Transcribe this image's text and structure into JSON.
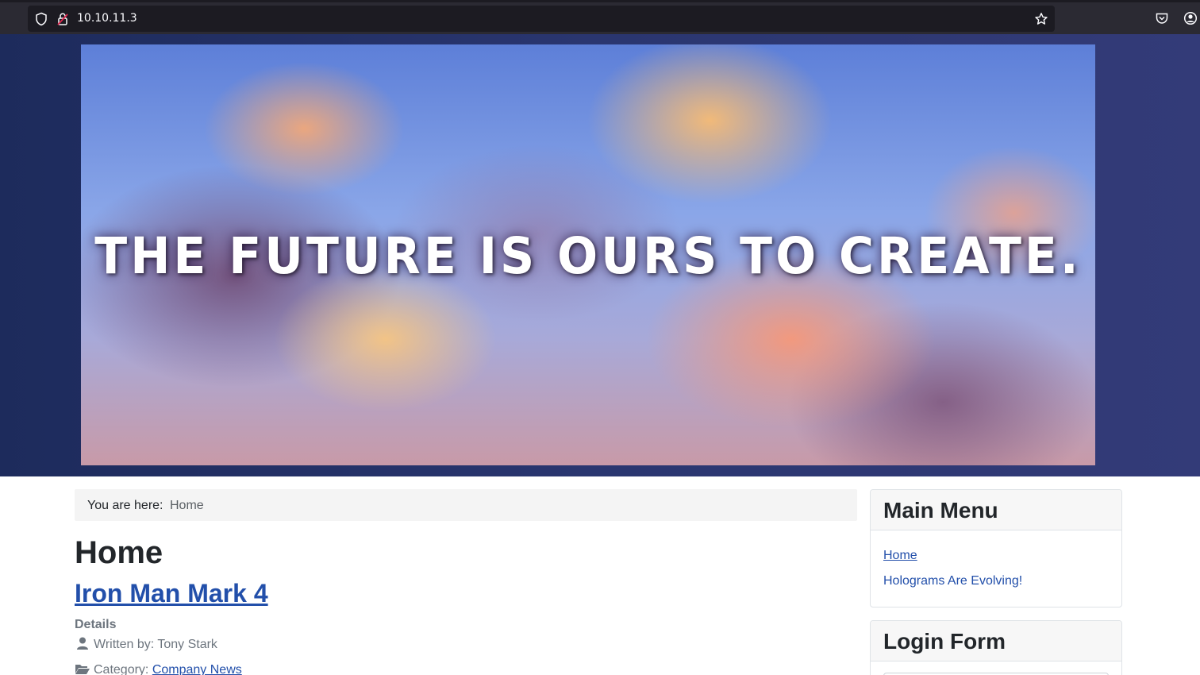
{
  "browser": {
    "url": "10.10.11.3",
    "icons": [
      "shield-icon",
      "insecure-lock-icon",
      "bookmark-star-icon",
      "pocket-icon",
      "account-icon"
    ]
  },
  "banner": {
    "text": "THE FUTURE IS OURS TO CREATE."
  },
  "breadcrumb": {
    "label": "You are here:",
    "current": "Home"
  },
  "main": {
    "page_title": "Home",
    "article_title": "Iron Man Mark 4",
    "details_label": "Details",
    "written_by": "Written by: Tony Stark",
    "category_label": "Category: ",
    "category_link": "Company News"
  },
  "sidebar": {
    "main_menu": {
      "title": "Main Menu",
      "items": [
        {
          "label": "Home"
        },
        {
          "label": "Holograms Are Evolving!"
        }
      ]
    },
    "login_form": {
      "title": "Login Form"
    }
  },
  "colors": {
    "link": "#224faa",
    "header_bg": "#2a3670",
    "chrome_bg": "#2b2a33"
  }
}
